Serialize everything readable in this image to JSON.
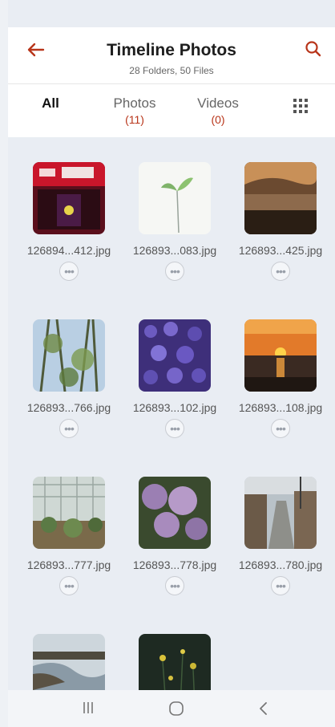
{
  "header": {
    "title": "Timeline Photos",
    "subtitle": "28 Folders, 50 Files"
  },
  "tabs": [
    {
      "label": "All",
      "count": ""
    },
    {
      "label": "Photos",
      "count": "(11)"
    },
    {
      "label": "Videos",
      "count": "(0)"
    }
  ],
  "files": [
    {
      "name": "126894...412.jpg"
    },
    {
      "name": "126893...083.jpg"
    },
    {
      "name": "126893...425.jpg"
    },
    {
      "name": "126893...766.jpg"
    },
    {
      "name": "126893...102.jpg"
    },
    {
      "name": "126893...108.jpg"
    },
    {
      "name": "126893...777.jpg"
    },
    {
      "name": "126893...778.jpg"
    },
    {
      "name": "126893...780.jpg"
    }
  ],
  "colors": {
    "accent": "#b8351a",
    "background": "#e9edf3"
  },
  "icons": {
    "back": "arrow-left-icon",
    "search": "search-icon",
    "grid": "grid-view-icon",
    "more": "more-horizontal-icon"
  }
}
